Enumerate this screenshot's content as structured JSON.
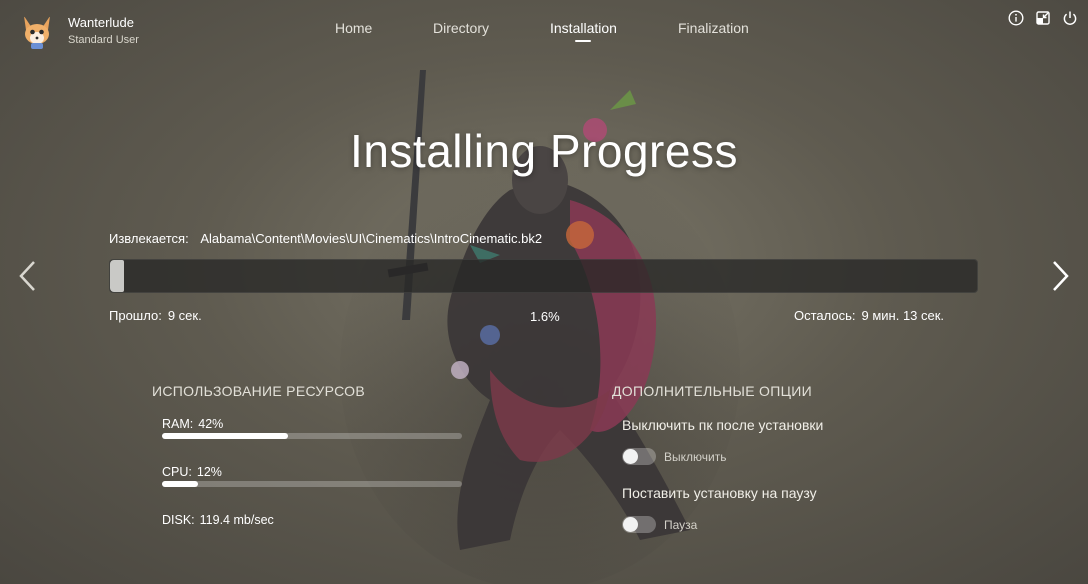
{
  "user": {
    "name": "Wanterlude",
    "role": "Standard User",
    "avatar_icon": "fox-avatar-icon"
  },
  "nav": {
    "items": [
      {
        "label": "Home",
        "active": false
      },
      {
        "label": "Directory",
        "active": false
      },
      {
        "label": "Installation",
        "active": true
      },
      {
        "label": "Finalization",
        "active": false
      }
    ]
  },
  "window_controls": [
    "info-icon",
    "minimize-icon",
    "power-icon"
  ],
  "title": "Installing Progress",
  "extract": {
    "label": "Извлекается:",
    "file": "Alabama\\Content\\Movies\\UI\\Cinematics\\IntroCinematic.bk2"
  },
  "progress": {
    "percent_value": 1.6,
    "percent_text": "1.6%",
    "elapsed_label": "Прошло:",
    "elapsed_value": "9 сек.",
    "remaining_label": "Осталось:",
    "remaining_value": "9 мин. 13 сек."
  },
  "resources": {
    "title": "ИСПОЛЬЗОВАНИЕ РЕСУРСОВ",
    "ram_label": "RAM:",
    "ram_value": "42%",
    "ram_fraction": 0.42,
    "cpu_label": "CPU:",
    "cpu_value": "12%",
    "cpu_fraction": 0.12,
    "disk_label": "DISK:",
    "disk_value": "119.4 mb/sec"
  },
  "options": {
    "title": "ДОПОЛНИТЕЛЬНЫЕ ОПЦИИ",
    "shutdown_label": "Выключить пк после установки",
    "shutdown_toggle_text": "Выключить",
    "shutdown_on": false,
    "pause_label": "Поставить установку на паузу",
    "pause_toggle_text": "Пауза",
    "pause_on": false
  },
  "colors": {
    "text": "#ffffff",
    "progress_fill": "#c9c9c6",
    "progress_track": "#2a2a28"
  }
}
